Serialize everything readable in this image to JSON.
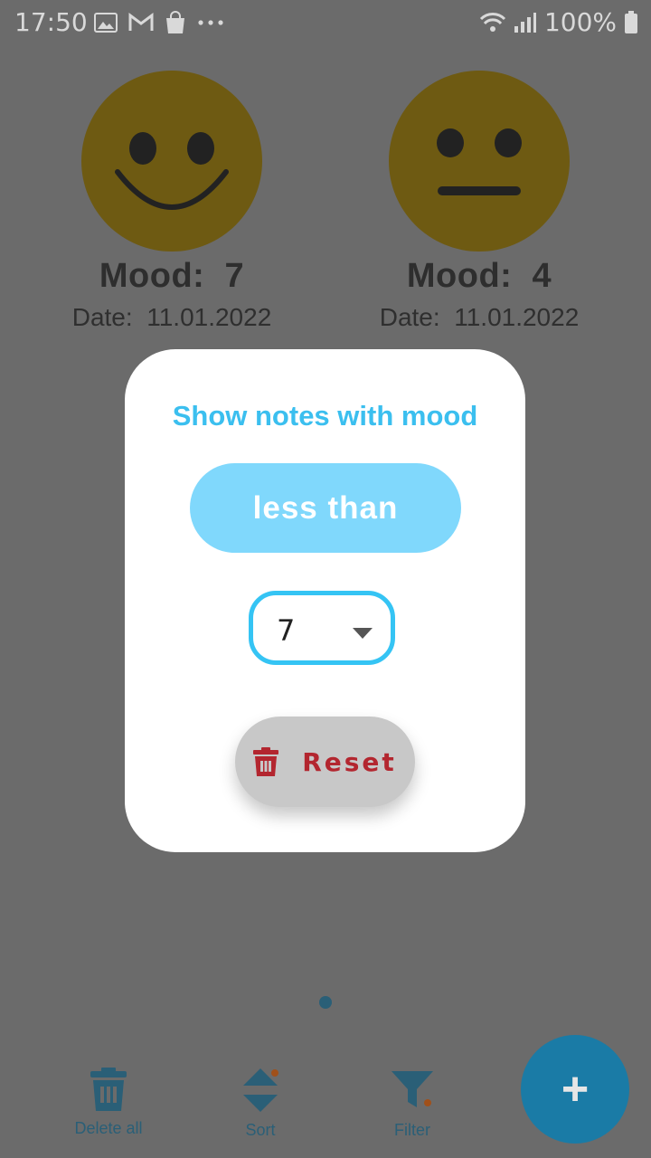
{
  "status_bar": {
    "time": "17:50",
    "battery": "100%",
    "left_icons": [
      "gallery-icon",
      "gmail-icon",
      "shopping-bag-icon",
      "more-icon"
    ],
    "right_icons": [
      "wifi-icon",
      "signal-icon",
      "battery-icon"
    ]
  },
  "notes": [
    {
      "mood_label": "Mood:",
      "mood_value": "7",
      "date_label": "Date:",
      "date_value": "11.01.2022",
      "face": "smile"
    },
    {
      "mood_label": "Mood:",
      "mood_value": "4",
      "date_label": "Date:",
      "date_value": "11.01.2022",
      "face": "neutral"
    }
  ],
  "dialog": {
    "title": "Show notes with mood",
    "comparison_button": "less than",
    "mood_select": {
      "value": "7"
    },
    "reset_label": "Reset"
  },
  "bottom_nav": {
    "delete_all": "Delete all",
    "sort": "Sort",
    "filter": "Filter"
  },
  "fab": {
    "label": "+"
  },
  "colors": {
    "overlay_bg": "#6b6b6b",
    "accent": "#35c4f4",
    "button_light_blue": "#80d8fc",
    "reset_red": "#b3262f",
    "nav_blue": "#2a5f77",
    "fab_blue": "#1a7ba6",
    "smiley_yellow": "#6e5a12"
  }
}
